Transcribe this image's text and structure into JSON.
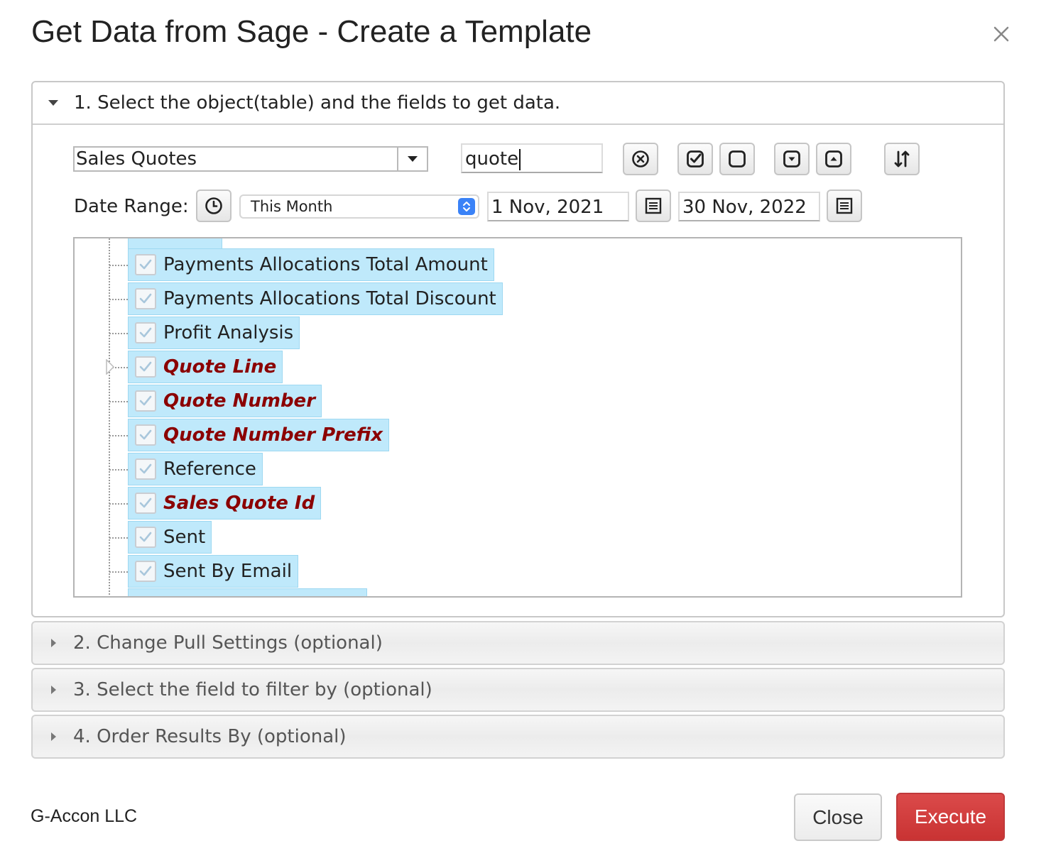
{
  "dialog": {
    "title": "Get Data from Sage - Create a Template",
    "close_icon": "close-icon"
  },
  "section1": {
    "label": "1. Select the object(table) and the fields to get data.",
    "object_select_value": "Sales Quotes",
    "search_value": "quote",
    "toolbar_icons": [
      "clear-search-icon",
      "check-all-icon",
      "uncheck-all-icon",
      "expand-all-icon",
      "collapse-all-icon",
      "sort-icon"
    ],
    "date_range_label": "Date Range:",
    "date_range_preset": "This Month",
    "date_from": "1 Nov, 2021",
    "date_to": "30 Nov, 2022",
    "fields": [
      {
        "label": "Payments Allocations Total Amount",
        "checked": true,
        "highlighted": false,
        "expandable": false
      },
      {
        "label": "Payments Allocations Total Discount",
        "checked": true,
        "highlighted": false,
        "expandable": false
      },
      {
        "label": "Profit Analysis",
        "checked": true,
        "highlighted": false,
        "expandable": false
      },
      {
        "label": "Quote Line",
        "checked": true,
        "highlighted": true,
        "expandable": true
      },
      {
        "label": "Quote Number",
        "checked": true,
        "highlighted": true,
        "expandable": false
      },
      {
        "label": "Quote Number Prefix",
        "checked": true,
        "highlighted": true,
        "expandable": false
      },
      {
        "label": "Reference",
        "checked": true,
        "highlighted": false,
        "expandable": false
      },
      {
        "label": "Sales Quote Id",
        "checked": true,
        "highlighted": true,
        "expandable": false
      },
      {
        "label": "Sent",
        "checked": true,
        "highlighted": false,
        "expandable": false
      },
      {
        "label": "Sent By Email",
        "checked": true,
        "highlighted": false,
        "expandable": false
      }
    ]
  },
  "section2": {
    "label": "2. Change Pull Settings (optional)"
  },
  "section3": {
    "label": "3. Select the field to filter by (optional)"
  },
  "section4": {
    "label": "4. Order Results By (optional)"
  },
  "footer": {
    "company": "G-Accon LLC",
    "close_label": "Close",
    "execute_label": "Execute"
  },
  "colors": {
    "highlight_text": "#8b0000",
    "item_bg": "#bfe9fb",
    "execute_bg": "#d33c3c",
    "select_stepper": "#3a82f7"
  }
}
